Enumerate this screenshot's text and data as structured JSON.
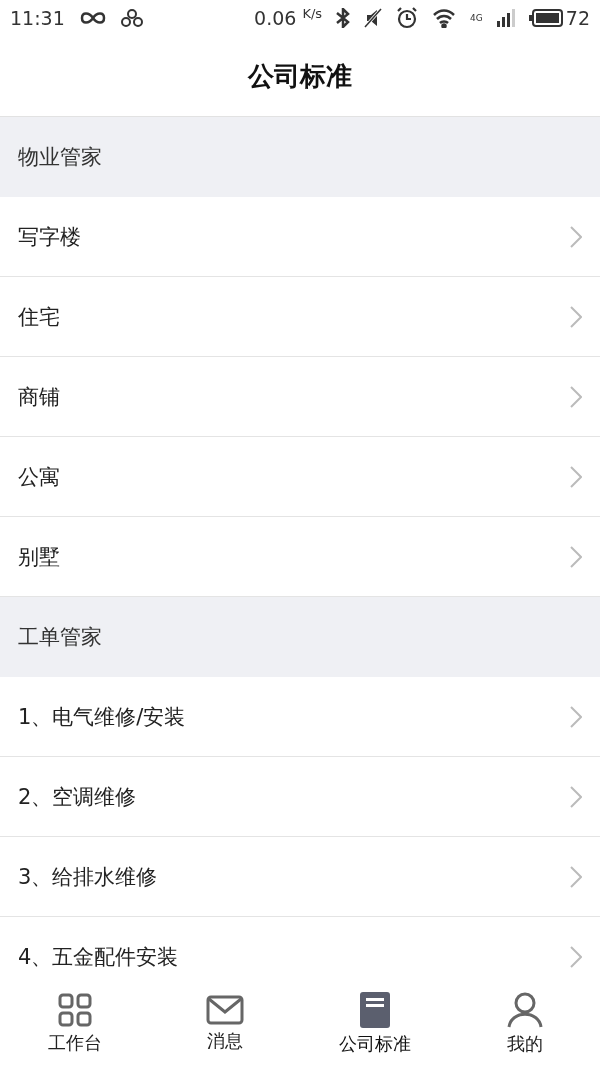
{
  "status_bar": {
    "time": "11:31",
    "speed": "0.06",
    "speed_unit": "K/s",
    "network": "4G",
    "battery": "72"
  },
  "header": {
    "title": "公司标准"
  },
  "sections": [
    {
      "title": "物业管家",
      "items": [
        "写字楼",
        "住宅",
        "商铺",
        "公寓",
        "别墅"
      ]
    },
    {
      "title": "工单管家",
      "items": [
        "1、电气维修/安装",
        "2、空调维修",
        "3、给排水维修",
        "4、五金配件安装"
      ]
    }
  ],
  "tabs": [
    {
      "kind": "grid",
      "label": "工作台",
      "selected": false
    },
    {
      "kind": "mail",
      "label": "消息",
      "selected": false
    },
    {
      "kind": "book",
      "label": "公司标准",
      "selected": true
    },
    {
      "kind": "user",
      "label": "我的",
      "selected": false
    }
  ]
}
